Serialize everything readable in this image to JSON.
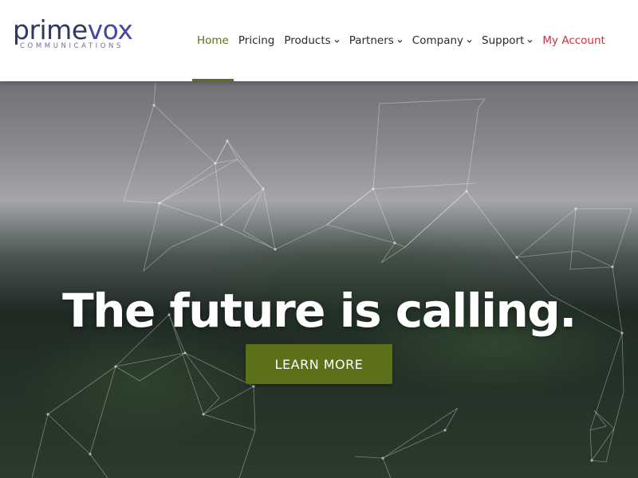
{
  "logo": {
    "word_prime": "prime",
    "word_vox": "vox",
    "tagline": "COMMUNICATIONS"
  },
  "nav": [
    {
      "label": "Home",
      "active": true,
      "dropdown": false
    },
    {
      "label": "Pricing",
      "active": false,
      "dropdown": false
    },
    {
      "label": "Products",
      "active": false,
      "dropdown": true
    },
    {
      "label": "Partners",
      "active": false,
      "dropdown": true
    },
    {
      "label": "Company",
      "active": false,
      "dropdown": true
    },
    {
      "label": "Support",
      "active": false,
      "dropdown": true
    },
    {
      "label": "My Account",
      "active": false,
      "dropdown": false
    }
  ],
  "hero": {
    "headline": "The future is calling.",
    "cta_label": "LEARN MORE"
  },
  "colors": {
    "accent_green": "#5b7018",
    "account_red": "#d2303f",
    "logo_navy": "#2e3a5c",
    "logo_purple": "#4a47a3"
  },
  "icons": {
    "dropdown": "chevron-down-icon"
  }
}
